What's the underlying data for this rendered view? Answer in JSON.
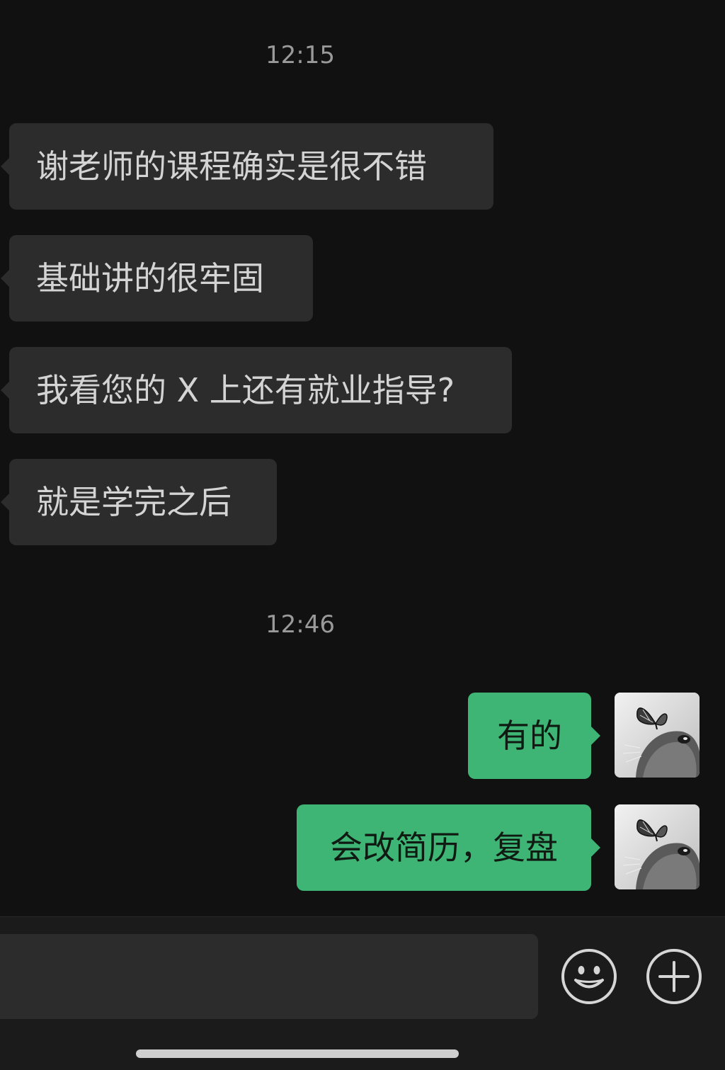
{
  "chat": {
    "timestamps": [
      "12:15",
      "12:46"
    ],
    "incoming": [
      "谢老师的课程确实是很不错",
      "基础讲的很牢固",
      "我看您的 X 上还有就业指导?",
      "就是学完之后"
    ],
    "outgoing": [
      "有的",
      "会改简历，复盘"
    ]
  },
  "input": {
    "value": "",
    "placeholder": ""
  },
  "icons": {
    "emoji": "smiley-face-icon",
    "more": "plus-circle-icon"
  },
  "colors": {
    "background": "#111111",
    "incoming_bubble": "#2c2c2c",
    "outgoing_bubble": "#3eb575"
  }
}
